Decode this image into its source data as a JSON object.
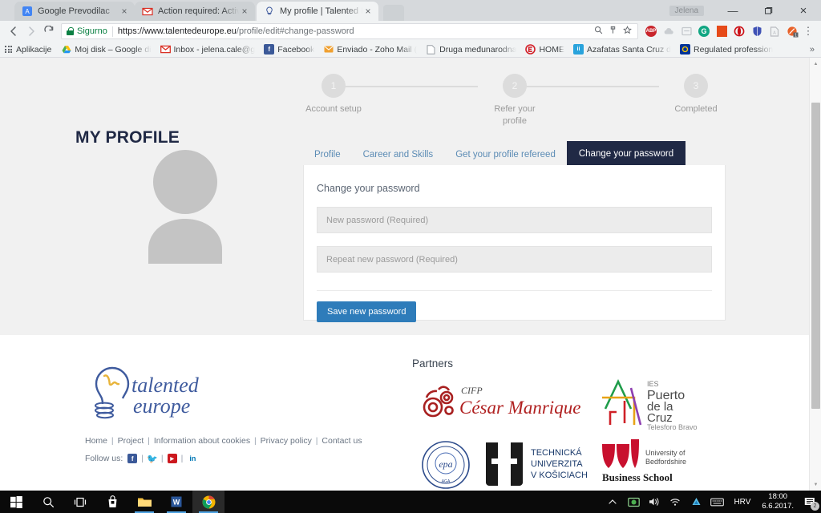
{
  "browser": {
    "user_chip": "Jelena",
    "window_controls": {
      "minimize": "—",
      "maximize": "❐",
      "close": "×"
    },
    "tabs": [
      {
        "title": "Google Prevodilac",
        "favicon": "google-translate-icon",
        "active": false
      },
      {
        "title": "Action required: Activate",
        "favicon": "gmail-icon",
        "active": false
      },
      {
        "title": "My profile | Talented Eur",
        "favicon": "talented-europe-icon",
        "active": true
      }
    ],
    "address_bar": {
      "security_label": "Sigurno",
      "url_host": "https://www.talentedeurope.eu",
      "url_path": "/profile/edit#change-password"
    },
    "bookmarks_label": "Aplikacije",
    "bookmarks": [
      {
        "label": "Moj disk – Google di",
        "icon": "google-drive-icon"
      },
      {
        "label": "Inbox - jelena.cale@g",
        "icon": "gmail-icon"
      },
      {
        "label": "Facebook",
        "icon": "facebook-icon"
      },
      {
        "label": "Enviado - Zoho Mail (",
        "icon": "zoho-mail-icon"
      },
      {
        "label": "Druga međunarodna",
        "icon": "document-icon"
      },
      {
        "label": "HOME",
        "icon": "home-e-icon"
      },
      {
        "label": "Azafatas Santa Cruz d",
        "icon": "azafatas-icon"
      },
      {
        "label": "Regulated profession",
        "icon": "eu-icon"
      }
    ],
    "bookmarks_overflow": "»",
    "extensions": [
      {
        "name": "adblock-plus-icon",
        "glyph": "ABP",
        "color": "#c9252c"
      },
      {
        "name": "cloud-icon",
        "glyph": "",
        "color": "#c9cdd1"
      },
      {
        "name": "notes-icon",
        "glyph": "",
        "color": "#d7dadd"
      },
      {
        "name": "grammarly-icon",
        "glyph": "G",
        "color": "#11a683"
      },
      {
        "name": "office-icon",
        "glyph": "",
        "color": "#e64a19"
      },
      {
        "name": "opera-icon",
        "glyph": "O",
        "color": "#cc0f16"
      },
      {
        "name": "shield-icon",
        "glyph": "",
        "color": "#3f51b5"
      },
      {
        "name": "pdf-icon",
        "glyph": "",
        "color": "#b9bcc0"
      },
      {
        "name": "avast-icon",
        "glyph": "",
        "color": "#e8622a"
      }
    ]
  },
  "page": {
    "title": "MY PROFILE",
    "steps": [
      {
        "number": "1",
        "label": "Account setup"
      },
      {
        "number": "2",
        "label": "Refer your\nprofile"
      },
      {
        "number": "3",
        "label": "Completed"
      }
    ],
    "step2_line1": "Refer your",
    "step2_line2": "profile",
    "avatar_alt": "default-user-avatar",
    "tabs": [
      {
        "label": "Profile",
        "active": false
      },
      {
        "label": "Career and Skills",
        "active": false
      },
      {
        "label": "Get your profile refereed",
        "active": false
      },
      {
        "label": "Change your password",
        "active": true
      }
    ],
    "form": {
      "heading": "Change your password",
      "new_password_placeholder": "New password (Required)",
      "new_password_value": "",
      "repeat_password_placeholder": "Repeat new password (Required)",
      "repeat_password_value": "",
      "save_button": "Save new password"
    },
    "footer": {
      "logo_text_1": "talented",
      "logo_text_2": "europe",
      "links": [
        "Home",
        "Project",
        "Information about cookies",
        "Privacy policy",
        "Contact us"
      ],
      "follow_label": "Follow us:",
      "social": [
        {
          "name": "facebook-icon",
          "glyph": "f",
          "color": "#3b5998"
        },
        {
          "name": "twitter-icon",
          "glyph": "t",
          "color": "#1da1f2"
        },
        {
          "name": "youtube-icon",
          "glyph": "▶",
          "color": "#cc181e"
        },
        {
          "name": "linkedin-icon",
          "glyph": "in",
          "color": "#0077b5"
        }
      ],
      "partners_heading": "Partners",
      "partners": [
        {
          "name": "cifp-cesar-manrique-logo",
          "line1": "CIFP",
          "line2": "César Manrique"
        },
        {
          "name": "ies-puerto-de-la-cruz-logo",
          "l1": "IES",
          "l2": "Puerto",
          "l3": "de la",
          "l4": "Cruz",
          "l5": "Telesforo Bravo"
        },
        {
          "name": "epa-seal-logo",
          "line1": "epa"
        },
        {
          "name": "technicka-univerzita-kosice-logo",
          "l1": "TECHNICKÁ",
          "l2": "UNIVERZITA",
          "l3": "V KOŠICIACH"
        },
        {
          "name": "university-of-bedfordshire-logo",
          "l1": "University of",
          "l2": "Bedfordshire",
          "l3": "Business School"
        }
      ]
    }
  },
  "taskbar": {
    "items": [
      {
        "name": "start-button",
        "icon": "windows-logo"
      },
      {
        "name": "search-button",
        "icon": "search-icon"
      },
      {
        "name": "task-view-button",
        "icon": "task-view-icon"
      },
      {
        "name": "store-button",
        "icon": "microsoft-store-icon"
      },
      {
        "name": "file-explorer-button",
        "icon": "folder-icon"
      },
      {
        "name": "word-button",
        "icon": "word-icon"
      },
      {
        "name": "chrome-button",
        "icon": "chrome-icon"
      }
    ],
    "tray": [
      {
        "name": "show-hidden-icons",
        "glyph": "⌃"
      },
      {
        "name": "antivirus-icon",
        "glyph": ""
      },
      {
        "name": "volume-icon",
        "glyph": ""
      },
      {
        "name": "wifi-icon",
        "glyph": ""
      },
      {
        "name": "onedrive-icon",
        "glyph": ""
      },
      {
        "name": "keyboard-icon",
        "glyph": ""
      }
    ],
    "language": "HRV",
    "time": "18:00",
    "date": "6.6.2017.",
    "notification_count": "2"
  }
}
